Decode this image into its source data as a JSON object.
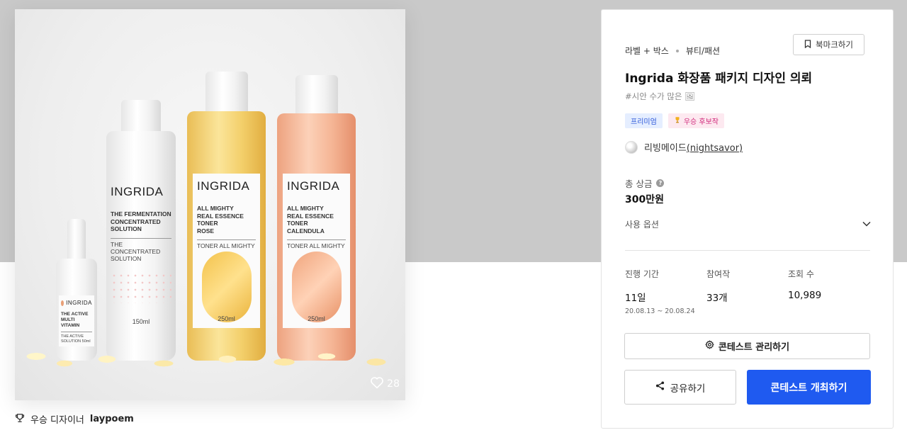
{
  "product_image": {
    "bottles": [
      {
        "brand": "INGRIDA",
        "desc": "THE ACTIVE\nMULTI VITAMIN",
        "sub": "THE ACTIVE\nSOLUTION   50ml",
        "volume": ""
      },
      {
        "brand": "INGRIDA",
        "desc": "THE FERMENTATION\nCONCENTRATED\nSOLUTION",
        "sub": "THE CONCENTRATED\nSOLUTION",
        "volume": "150ml"
      },
      {
        "brand": "INGRIDA",
        "desc": "ALL MIGHTY\nREAL ESSENCE TONER\nROSE",
        "sub": "TONER ALL MIGHTY",
        "volume": "250ml"
      },
      {
        "brand": "INGRIDA",
        "desc": "ALL MIGHTY\nREAL ESSENCE TONER\nCALENDULA",
        "sub": "TONER ALL MIGHTY",
        "volume": "250ml"
      }
    ],
    "like_count": "28",
    "like_icon": "heart-outline-icon"
  },
  "winner": {
    "icon": "trophy-icon",
    "label": "우승 디자이너",
    "name": "laypoem"
  },
  "contest": {
    "category": "라벨 + 박스",
    "subcategory": "뷰티/패션",
    "bookmark_label": "북마크하기",
    "title": "Ingrida 화장품 패키지 디자인 의뢰",
    "tagline": "#시안 수가 많은 🖼",
    "badges": {
      "premium": "프리미엄",
      "candidate": "우승 후보작"
    },
    "host_name": "리빙메이드",
    "host_handle": "(nightsavor)",
    "prize_label": "총 상금",
    "prize_value": "300만원",
    "options_label": "사용 옵션",
    "stats": {
      "period_label": "진행 기간",
      "period_value": "11일",
      "period_dates": "20.08.13  ~  20.08.24",
      "participants_label": "참여작",
      "participants_value": "33개",
      "views_label": "조회 수",
      "views_value": "10,989"
    },
    "manage_label": "콘테스트 관리하기",
    "share_label": "공유하기",
    "host_contest_label": "콘테스트 개최하기"
  },
  "colors": {
    "primary": "#1f5af0",
    "premium_bg": "#e5eeff",
    "premium_text": "#2b56d8",
    "candidate_bg": "#fde9f0",
    "candidate_text": "#d0287a"
  }
}
